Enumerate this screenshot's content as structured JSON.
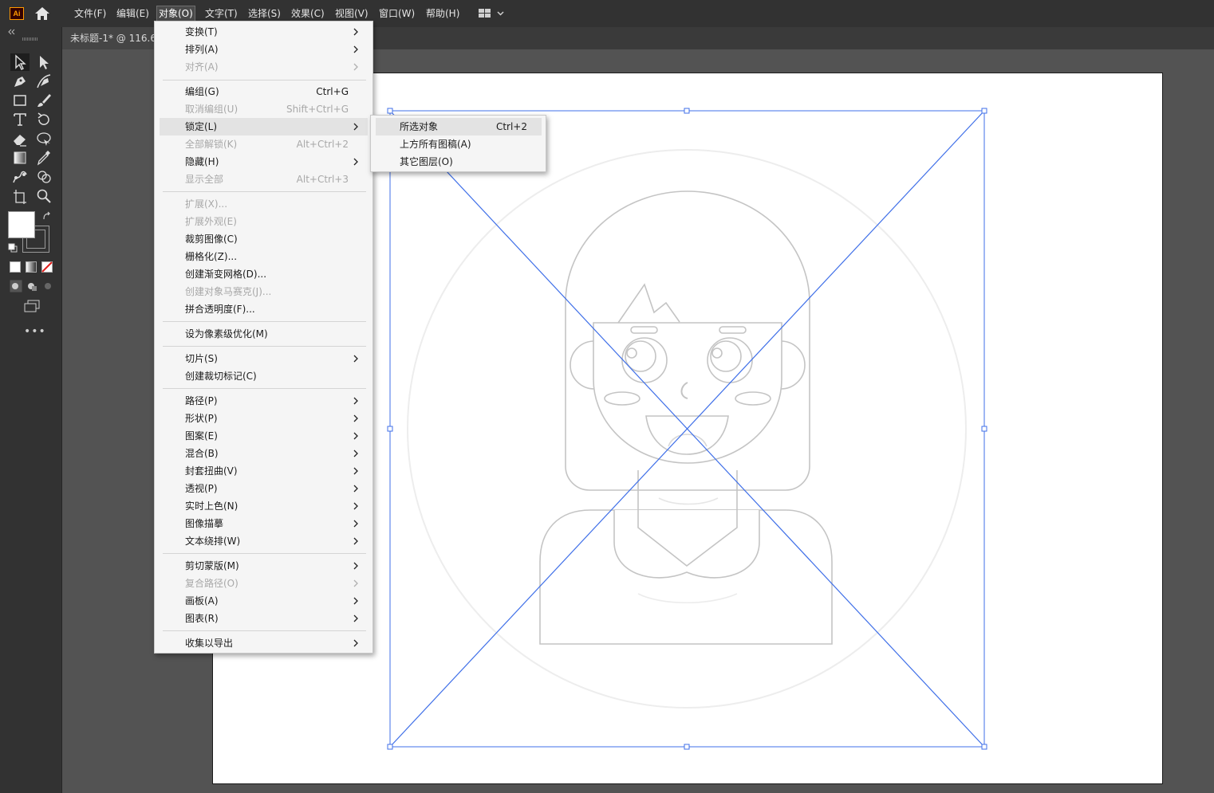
{
  "app": {
    "logo_text": "Ai"
  },
  "menubar": {
    "items": [
      {
        "label": "文件(F)"
      },
      {
        "label": "编辑(E)"
      },
      {
        "label": "对象(O)"
      },
      {
        "label": "文字(T)"
      },
      {
        "label": "选择(S)"
      },
      {
        "label": "效果(C)"
      },
      {
        "label": "视图(V)"
      },
      {
        "label": "窗口(W)"
      },
      {
        "label": "帮助(H)"
      }
    ]
  },
  "document": {
    "tab_label": "未标题-1* @ 116.6"
  },
  "object_menu": {
    "items": [
      {
        "label": "变换(T)",
        "shortcut": ""
      },
      {
        "label": "排列(A)",
        "shortcut": ""
      },
      {
        "label": "对齐(A)",
        "shortcut": ""
      },
      {
        "label": "编组(G)",
        "shortcut": "Ctrl+G"
      },
      {
        "label": "取消编组(U)",
        "shortcut": "Shift+Ctrl+G"
      },
      {
        "label": "锁定(L)",
        "shortcut": ""
      },
      {
        "label": "全部解锁(K)",
        "shortcut": "Alt+Ctrl+2"
      },
      {
        "label": "隐藏(H)",
        "shortcut": ""
      },
      {
        "label": "显示全部",
        "shortcut": "Alt+Ctrl+3"
      },
      {
        "label": "扩展(X)...",
        "shortcut": ""
      },
      {
        "label": "扩展外观(E)",
        "shortcut": ""
      },
      {
        "label": "裁剪图像(C)",
        "shortcut": ""
      },
      {
        "label": "栅格化(Z)...",
        "shortcut": ""
      },
      {
        "label": "创建渐变网格(D)...",
        "shortcut": ""
      },
      {
        "label": "创建对象马赛克(J)...",
        "shortcut": ""
      },
      {
        "label": "拼合透明度(F)...",
        "shortcut": ""
      },
      {
        "label": "设为像素级优化(M)",
        "shortcut": ""
      },
      {
        "label": "切片(S)",
        "shortcut": ""
      },
      {
        "label": "创建裁切标记(C)",
        "shortcut": ""
      },
      {
        "label": "路径(P)",
        "shortcut": ""
      },
      {
        "label": "形状(P)",
        "shortcut": ""
      },
      {
        "label": "图案(E)",
        "shortcut": ""
      },
      {
        "label": "混合(B)",
        "shortcut": ""
      },
      {
        "label": "封套扭曲(V)",
        "shortcut": ""
      },
      {
        "label": "透视(P)",
        "shortcut": ""
      },
      {
        "label": "实时上色(N)",
        "shortcut": ""
      },
      {
        "label": "图像描摹",
        "shortcut": ""
      },
      {
        "label": "文本绕排(W)",
        "shortcut": ""
      },
      {
        "label": "剪切蒙版(M)",
        "shortcut": ""
      },
      {
        "label": "复合路径(O)",
        "shortcut": ""
      },
      {
        "label": "画板(A)",
        "shortcut": ""
      },
      {
        "label": "图表(R)",
        "shortcut": ""
      },
      {
        "label": "收集以导出",
        "shortcut": ""
      }
    ]
  },
  "lock_submenu": {
    "items": [
      {
        "label": "所选对象",
        "shortcut": "Ctrl+2"
      },
      {
        "label": "上方所有图稿(A)",
        "shortcut": ""
      },
      {
        "label": "其它图层(O)",
        "shortcut": ""
      }
    ]
  }
}
